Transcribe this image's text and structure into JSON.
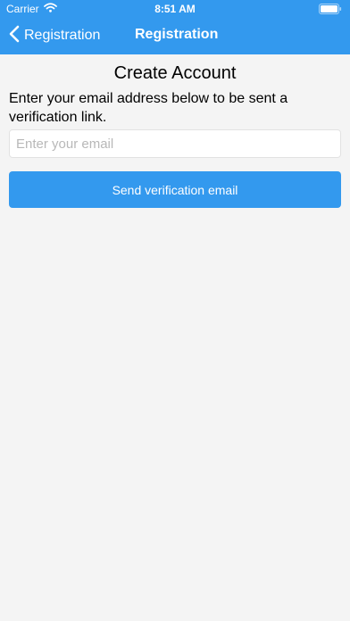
{
  "status_bar": {
    "carrier": "Carrier",
    "wifi_icon": "wifi-icon",
    "time": "8:51 AM",
    "battery_icon": "battery-icon"
  },
  "nav": {
    "back_icon": "chevron-left-icon",
    "back_label": "Registration",
    "title": "Registration"
  },
  "main": {
    "title": "Create Account",
    "instructions": "Enter your email address below to be sent a verification link.",
    "email_placeholder": "Enter your email",
    "email_value": "",
    "send_button_label": "Send verification email"
  },
  "colors": {
    "header_background": "#3399ee",
    "button_background": "#3399ee",
    "page_background": "#f4f4f4"
  }
}
